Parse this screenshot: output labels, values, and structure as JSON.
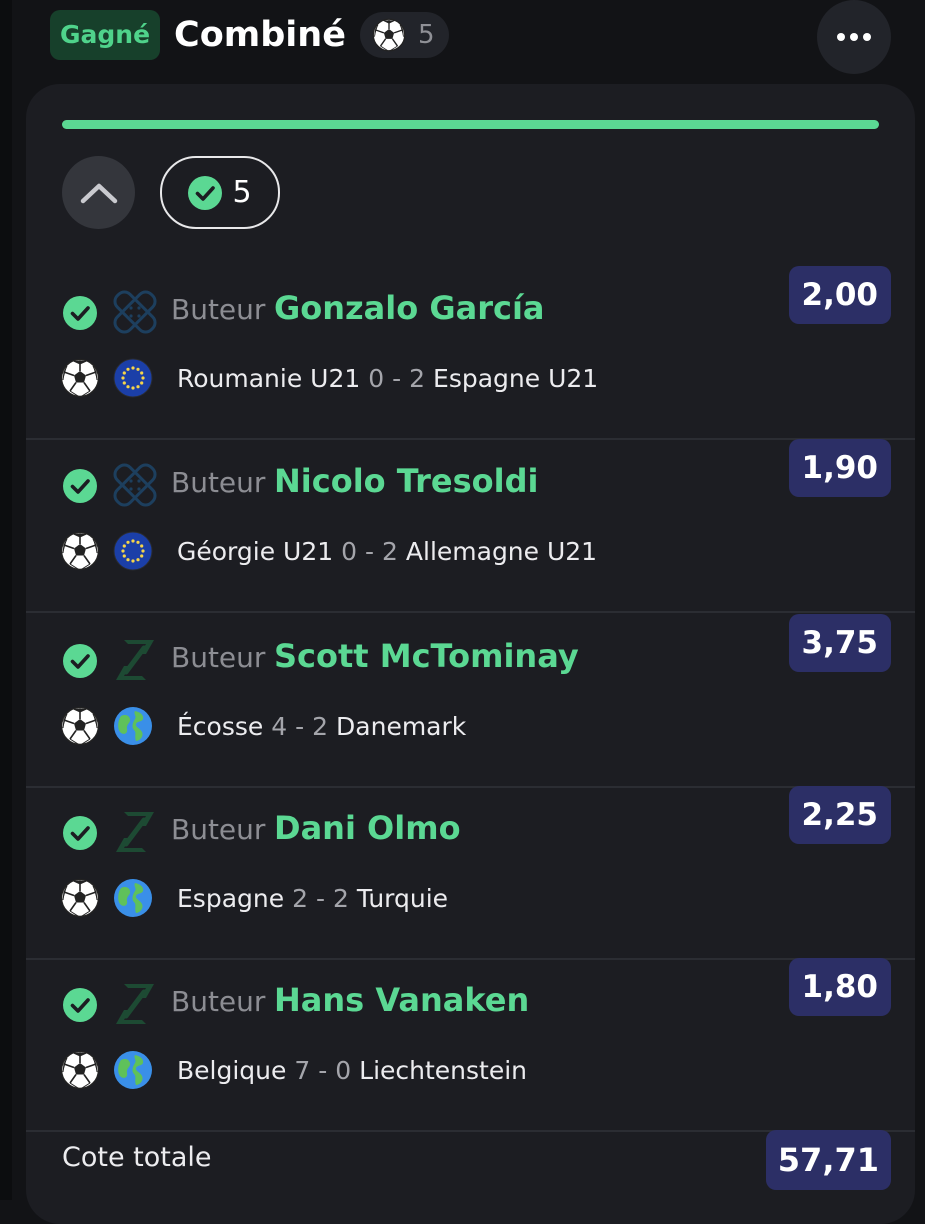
{
  "header": {
    "status_badge": "Gagné",
    "title": "Combiné",
    "selection_count": "5",
    "more_icon": "more-horizontal-icon"
  },
  "colors": {
    "background": "#121316",
    "card": "#1c1d22",
    "accent_green": "#5bd893",
    "odds_bg": "#2c2f66"
  },
  "bet": {
    "progress_fraction": 1.0,
    "won_count": "5",
    "selections": [
      {
        "market": "Buteur",
        "player": "Gonzalo García",
        "odds": "2,00",
        "market_icon": "bandage-icon",
        "competition_icon": "eu-flag-icon",
        "home": "Roumanie U21",
        "home_score": "0",
        "sep": "-",
        "away_score": "2",
        "away": "Espagne U21"
      },
      {
        "market": "Buteur",
        "player": "Nicolo Tresoldi",
        "odds": "1,90",
        "market_icon": "bandage-icon",
        "competition_icon": "eu-flag-icon",
        "home": "Géorgie U21",
        "home_score": "0",
        "sep": "-",
        "away_score": "2",
        "away": "Allemagne U21"
      },
      {
        "market": "Buteur",
        "player": "Scott McTominay",
        "odds": "3,75",
        "market_icon": "boost-icon",
        "competition_icon": "globe-icon",
        "home": "Écosse",
        "home_score": "4",
        "sep": "-",
        "away_score": "2",
        "away": "Danemark"
      },
      {
        "market": "Buteur",
        "player": "Dani Olmo",
        "odds": "2,25",
        "market_icon": "boost-icon",
        "competition_icon": "globe-icon",
        "home": "Espagne",
        "home_score": "2",
        "sep": "-",
        "away_score": "2",
        "away": "Turquie"
      },
      {
        "market": "Buteur",
        "player": "Hans Vanaken",
        "odds": "1,80",
        "market_icon": "boost-icon",
        "competition_icon": "globe-icon",
        "home": "Belgique",
        "home_score": "7",
        "sep": "-",
        "away_score": "0",
        "away": "Liechtenstein"
      }
    ],
    "total_label": "Cote totale",
    "total_odds": "57,71"
  }
}
